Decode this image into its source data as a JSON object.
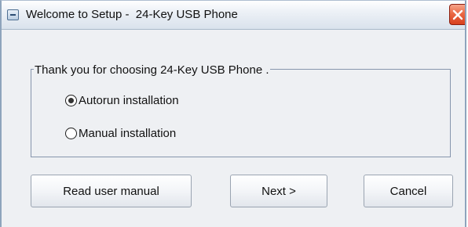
{
  "window": {
    "title": "Welcome to Setup -  24-Key USB Phone"
  },
  "group": {
    "legend": "Thank you for choosing 24-Key USB Phone ."
  },
  "options": [
    {
      "label": "Autorun installation",
      "selected": true
    },
    {
      "label": "Manual installation",
      "selected": false
    }
  ],
  "buttons": {
    "read_manual": "Read user manual",
    "next": "Next >",
    "cancel": "Cancel"
  },
  "colors": {
    "close_button": "#e0502c",
    "frame": "#8ea4bc",
    "group_border": "#8695ad",
    "background": "#eef0f3"
  }
}
